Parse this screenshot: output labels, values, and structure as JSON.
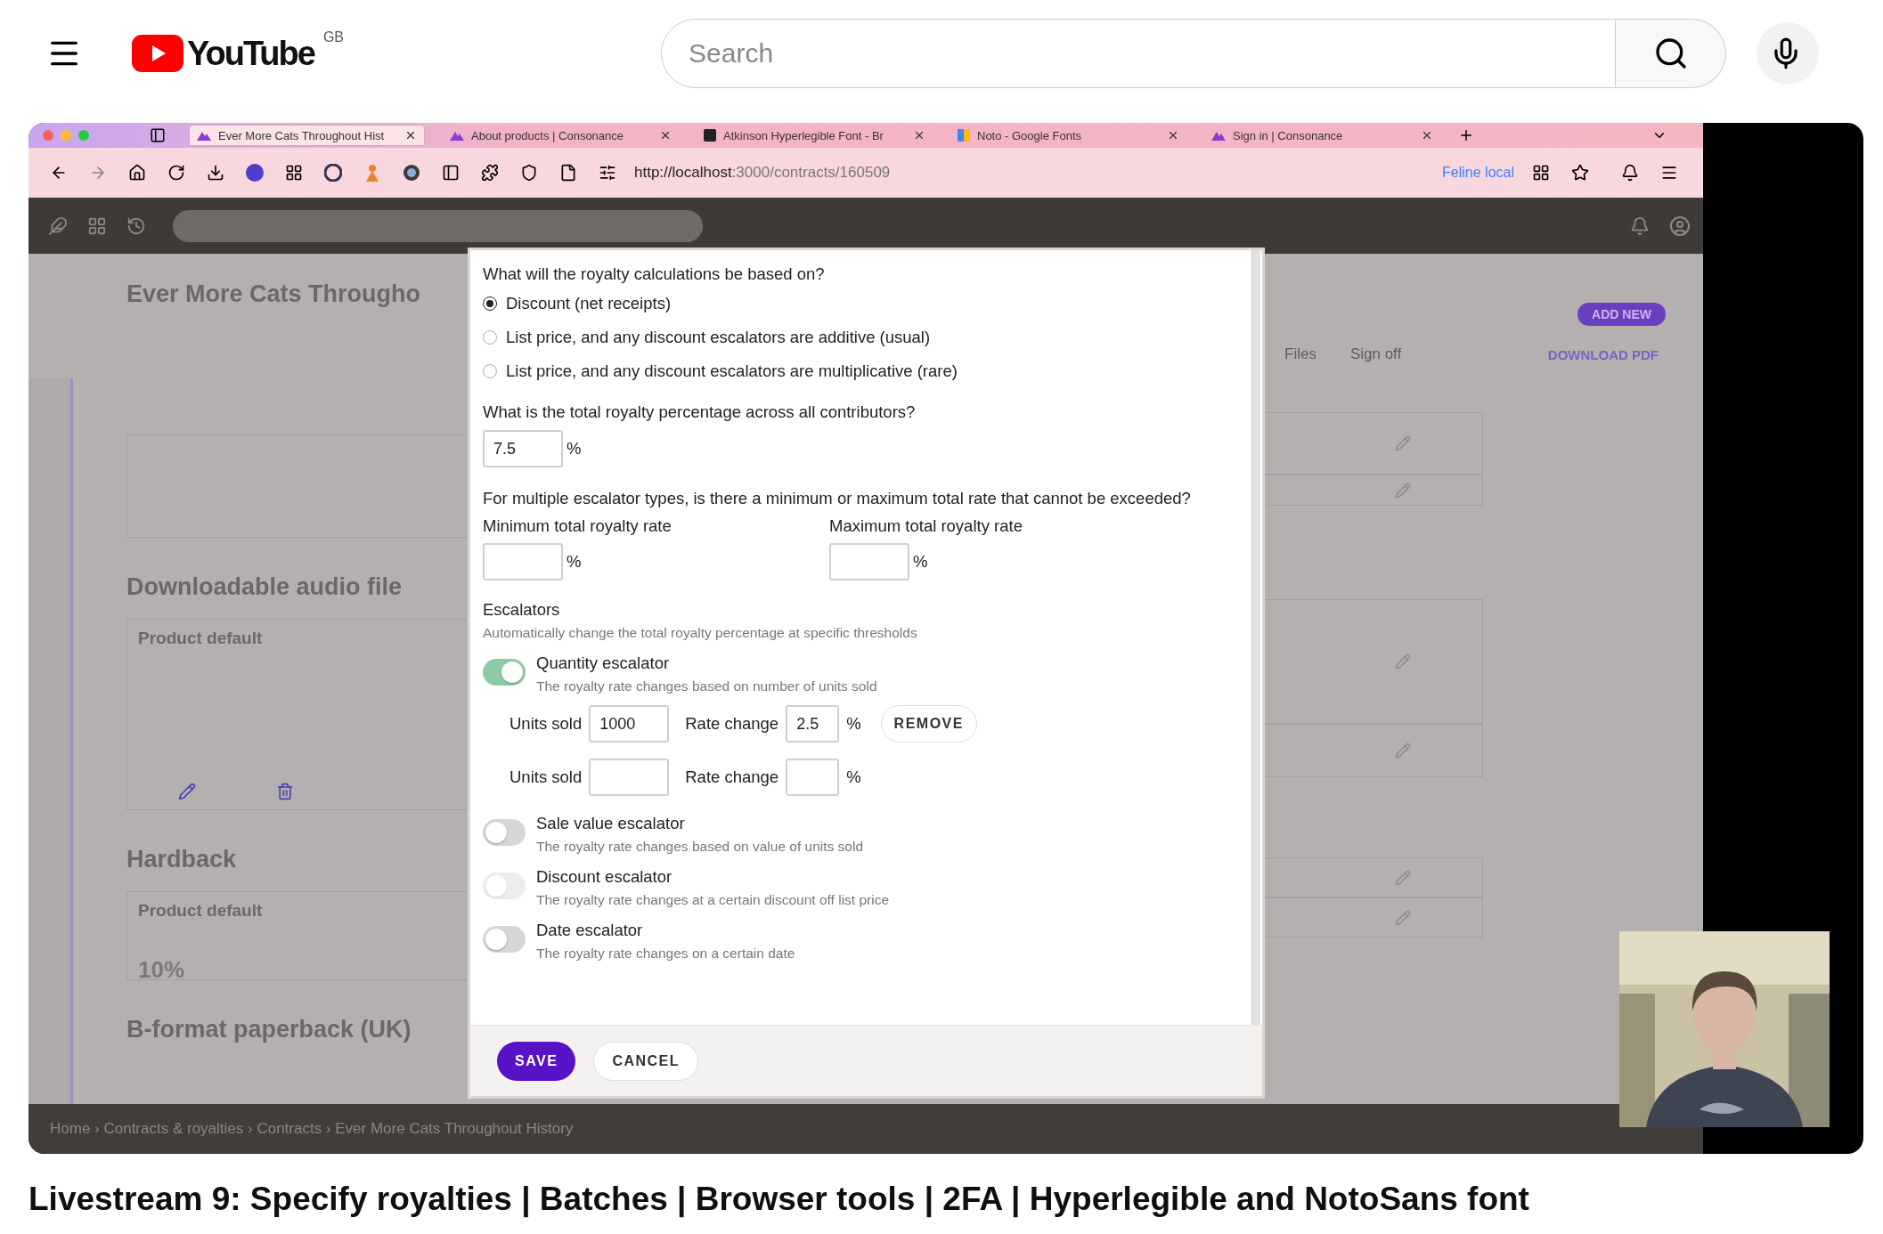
{
  "youtube": {
    "logo_text": "YouTube",
    "region": "GB",
    "search": {
      "placeholder": "Search"
    }
  },
  "video": {
    "browser": {
      "tabs": [
        {
          "title": "Ever More Cats Throughout Hist",
          "selected": true
        },
        {
          "title": "About products | Consonance",
          "selected": false
        },
        {
          "title": "Atkinson Hyperlegible Font - Br",
          "selected": false
        },
        {
          "title": "Noto - Google Fonts",
          "selected": false
        },
        {
          "title": "Sign in | Consonance",
          "selected": false
        }
      ],
      "address_host": "http://localhost",
      "address_path": ":3000/contracts/160509",
      "profile": "Feline local"
    },
    "page": {
      "title": "Ever More Cats Througho",
      "add_button": "ADD NEW",
      "links": [
        "Files",
        "Sign off"
      ],
      "download": "DOWNLOAD PDF",
      "sections": [
        {
          "heading": "Downloadable audio file",
          "card": "Product default"
        },
        {
          "heading": "Hardback",
          "card": "Product default",
          "value": "10%"
        },
        {
          "heading": "B-format paperback (UK)"
        }
      ],
      "breadcrumb": "Home › Contracts & royalties › Contracts › Ever More Cats Throughout History"
    },
    "dialog": {
      "basis": {
        "question": "What will the royalty calculations be based on?",
        "options": [
          {
            "label": "Discount (net receipts)",
            "selected": true
          },
          {
            "label": "List price, and any discount escalators are additive (usual)",
            "selected": false
          },
          {
            "label": "List price, and any discount escalators are multiplicative (rare)",
            "selected": false
          }
        ]
      },
      "total": {
        "question": "What is the total royalty percentage across all contributors?",
        "value": "7.5",
        "unit": "%"
      },
      "limits": {
        "question": "For multiple escalator types, is there a minimum or maximum total rate that cannot be exceeded?",
        "fields": [
          {
            "label": "Minimum total royalty rate",
            "unit": "%"
          },
          {
            "label": "Maximum total royalty rate",
            "unit": "%"
          }
        ]
      },
      "escalators": {
        "heading": "Escalators",
        "hint": "Automatically change the total royalty percentage at specific thresholds",
        "items": [
          {
            "name": "Quantity escalator",
            "description": "The royalty rate changes based on number of units sold",
            "on": true,
            "disabled": false,
            "rows": [
              {
                "units_label": "Units sold",
                "units": "1000",
                "rate_label": "Rate change",
                "rate": "2.5",
                "unit": "%",
                "remove": "REMOVE"
              },
              {
                "units_label": "Units sold",
                "rate_label": "Rate change",
                "unit": "%"
              }
            ]
          },
          {
            "name": "Sale value escalator",
            "description": "The royalty rate changes based on value of units sold",
            "on": false,
            "disabled": false
          },
          {
            "name": "Discount escalator",
            "description": "The royalty rate changes at a certain discount off list price",
            "on": false,
            "disabled": true
          },
          {
            "name": "Date escalator",
            "description": "The royalty rate changes on a certain date",
            "on": false,
            "disabled": false
          }
        ]
      },
      "buttons": [
        {
          "label": "SAVE",
          "kind": "primary"
        },
        {
          "label": "CANCEL",
          "kind": "secondary"
        }
      ]
    }
  },
  "video_title": "Livestream 9: Specify royalties | Batches | Browser tools | 2FA | Hyperlegible and NotoSans font"
}
